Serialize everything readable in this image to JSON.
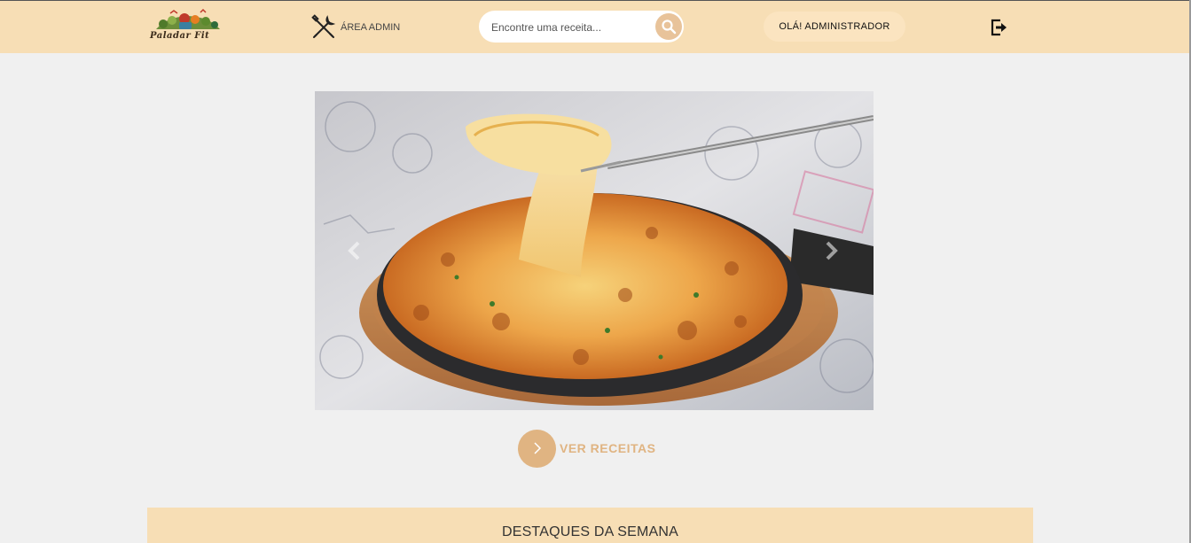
{
  "brand": {
    "name": "Paladar Fit",
    "logo_icon": "paladar-fit-logo"
  },
  "header": {
    "admin_label": "ÁREA ADMIN",
    "admin_icon": "tools-icon",
    "search": {
      "placeholder": "Encontre uma receita...",
      "value": "",
      "icon": "search-icon"
    },
    "greeting": "OLÁ! ADMINISTRADOR",
    "logout_icon": "logout-icon"
  },
  "carousel": {
    "image_alt": "",
    "prev_icon": "chevron-left-icon",
    "next_icon": "chevron-right-icon"
  },
  "cta": {
    "label": "VER RECEITAS",
    "icon": "chevron-right-icon"
  },
  "featured": {
    "title": "DESTAQUES DA SEMANA"
  },
  "colors": {
    "header_bg": "#f7deb5",
    "accent": "#e0b482",
    "greeting_bg": "#fbe4c0",
    "page_bg": "#f0f0f0"
  }
}
